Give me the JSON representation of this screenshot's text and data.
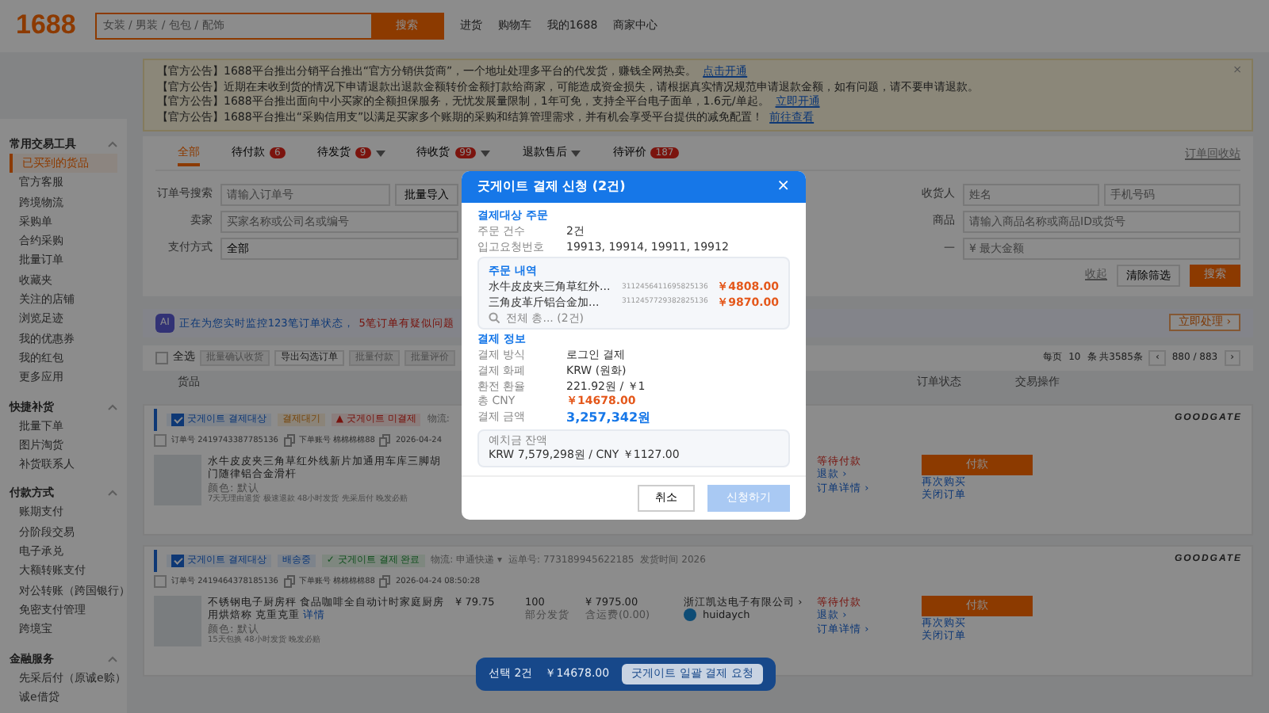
{
  "header": {
    "logo": "1688",
    "search_placeholder": "女装 / 男装 / 包包 / 配饰",
    "search_button": "搜索",
    "links": [
      "进货",
      "购物车",
      "我的1688",
      "商家中心"
    ]
  },
  "notices": {
    "close": "×",
    "items": [
      {
        "text": "【官方公告】1688平台推出分销平台推出“官方分销供货商”，一个地址处理多平台的代发货，赚钱全网热卖。",
        "link": "点击开通"
      },
      {
        "text": "【官方公告】近期在未收到货的情况下申请退款出退款金额转价金额打款给商家，可能造成资金损失，请根据真实情况规范申请退款金额，如有问题，请不要申请退款。"
      },
      {
        "text": "【官方公告】1688平台推出面向中小买家的全额担保服务，无忧发展量限制，1年可免，支持全平台电子面单，1.6元/单起。",
        "link": "立即开通"
      },
      {
        "text": "【官方公告】1688平台推出“采购信用支”以满足买家多个账期的采购和结算管理需求，并有机会享受平台提供的减免配置！",
        "link": "前往查看"
      }
    ]
  },
  "sidebar": {
    "sections": [
      {
        "title": "常用交易工具",
        "items": [
          {
            "label": "已买到的货品",
            "selected": true
          },
          {
            "label": "官方客服",
            "selected": false
          },
          {
            "label": "跨境物流",
            "selected": false
          },
          {
            "label": "采购单",
            "selected": false
          },
          {
            "label": "合约采购",
            "selected": false
          },
          {
            "label": "批量订单",
            "selected": false
          },
          {
            "label": "收藏夹",
            "selected": false
          },
          {
            "label": "关注的店铺",
            "selected": false
          },
          {
            "label": "浏览足迹",
            "selected": false
          },
          {
            "label": "我的优惠券",
            "selected": false
          },
          {
            "label": "我的红包",
            "selected": false
          },
          {
            "label": "更多应用",
            "selected": false
          }
        ]
      },
      {
        "title": "快捷补货",
        "items": [
          {
            "label": "批量下单",
            "selected": false
          },
          {
            "label": "图片淘货",
            "selected": false
          },
          {
            "label": "补货联系人",
            "selected": false
          }
        ]
      },
      {
        "title": "付款方式",
        "items": [
          {
            "label": "账期支付",
            "selected": false
          },
          {
            "label": "分阶段交易",
            "selected": false
          },
          {
            "label": "电子承兑",
            "selected": false
          },
          {
            "label": "大额转账支付",
            "selected": false
          },
          {
            "label": "对公转账（跨国银行）",
            "selected": false
          },
          {
            "label": "免密支付管理",
            "selected": false
          },
          {
            "label": "跨境宝",
            "selected": false
          }
        ]
      },
      {
        "title": "金融服务",
        "items": [
          {
            "label": "先采后付（原诚e赊）",
            "selected": false
          },
          {
            "label": "诚e借贷",
            "selected": false
          }
        ]
      }
    ]
  },
  "tabs": [
    {
      "label": "全部",
      "selected": true
    },
    {
      "label": "待付款",
      "badge": "6",
      "selected": false
    },
    {
      "label": "待发货",
      "badge": "9",
      "dropdown": true,
      "selected": false
    },
    {
      "label": "待收货",
      "badge": "99",
      "dropdown": true,
      "selected": false
    },
    {
      "label": "退款售后",
      "dropdown": true,
      "selected": false
    },
    {
      "label": "待评价",
      "badge": "187",
      "selected": false
    }
  ],
  "recycle_link": "订单回收站",
  "filters": {
    "rows": [
      {
        "label": "订单号搜索",
        "placeholder": "请输入订单号",
        "button": "批量导入",
        "right_label": "收货人",
        "right_placeholders": [
          "姓名",
          "手机号码"
        ]
      },
      {
        "label": "卖家",
        "placeholder": "买家名称或公司名或编号",
        "right_label": "商品",
        "right_placeholders": [
          "请输入商品名称或商品ID或货号"
        ]
      },
      {
        "label": "支付方式",
        "value": "全部",
        "right_label": "—",
        "right_placeholders": [
          "¥ 最大金额"
        ]
      }
    ],
    "collapse": "收起",
    "clear": "清除筛选",
    "search": "搜索"
  },
  "ai_banner": {
    "icon": "AI",
    "message": "正在为您实时监控123笔订单状态，",
    "alert": "5笔订单有疑似问题",
    "action": "立即处理 ›"
  },
  "list_toolbar": {
    "select_all": "全选",
    "select_all_checked": false,
    "buttons": [
      {
        "label": "批量确认收货",
        "disabled": true
      },
      {
        "label": "导出勾选订单",
        "disabled": false
      },
      {
        "label": "批量付款",
        "disabled": true
      },
      {
        "label": "批量评价",
        "disabled": true
      }
    ],
    "per_page_label": "每页",
    "per_page": "10",
    "total": "条 共3585条",
    "prev": "‹",
    "page": "880 / 883",
    "next": "›"
  },
  "columns": [
    "货品",
    "订单状态",
    "交易操作"
  ],
  "orders": [
    {
      "goodgate_checked": true,
      "goodgate_tag": "굿게이트 결제대상",
      "status_tag": {
        "kind": "pending",
        "text": "결제대기"
      },
      "pay_flag": {
        "kind": "warning",
        "text": "▲ 굿게이트 미결제"
      },
      "logistics": "物流:",
      "brand": "GOODGATE",
      "selected": false,
      "order_no": "订单号 2419743387785136",
      "account": "下单账号 棉棉棉棉88",
      "time": "2026-04-24",
      "product": {
        "title": "水牛皮皮夹三角草红外线新片加通用车库三脚胡门随律铝合金滑杆",
        "variant": "颜色: 默认",
        "tags": "7天无理由退货 极速退款 48小时发货 先采后付 晚发必赔"
      },
      "status": "等待付款",
      "refund": "退款 ›",
      "detail": "订单详情 ›",
      "actions": {
        "pay": "付款",
        "rebuy": "再次购买",
        "close": "关闭订单"
      }
    },
    {
      "goodgate_checked": true,
      "goodgate_tag": "굿게이트 결제대상",
      "status_tag": {
        "kind": "shipping",
        "text": "배송중"
      },
      "pay_flag": {
        "kind": "done",
        "text": "✓ 굿게이트 결제 완료"
      },
      "logistics": "物流: 申通快递 ▾",
      "waybill": "运单号: 773189945622185",
      "ship_time": "发货时间 2026",
      "brand": "GOODGATE",
      "selected": false,
      "order_no": "订单号 2419464378185136",
      "account": "下单账号 棉棉棉棉88",
      "time": "2026-04-24 08:50:28",
      "product": {
        "title": "不锈钢电子厨房秤 食品咖啡全自动计时家庭厨房用烘焙称 克重克重",
        "tag": "详情",
        "variant": "颜色: 默认",
        "tags": "15天包换 48小时发货 晚发必赔"
      },
      "price": "¥ 79.75",
      "qty": "100",
      "qty_note": "部分发货",
      "total": "¥ 7975.00",
      "total_note": "含运费(0.00)",
      "seller": "浙江凯达电子有限公司 ›",
      "seller_im": "huidaych",
      "status": "等待付款",
      "refund": "退款 ›",
      "detail": "订单详情 ›",
      "actions": {
        "pay": "付款",
        "rebuy": "再次购买",
        "close": "关闭订单"
      }
    }
  ],
  "bottom_bar": {
    "selected": "선택 2건",
    "amount": "￥14678.00",
    "button": "굿게이트 일괄 결제 요청"
  },
  "modal": {
    "title": "굿게이트 결제 신청 (2건)",
    "close": "×",
    "target": {
      "heading": "결제대상 주문",
      "rows": [
        {
          "label": "주문 건수",
          "value": "2건"
        },
        {
          "label": "입고요청번호",
          "value": "19913, 19914, 19911, 19912"
        }
      ]
    },
    "orders_box": {
      "heading": "주문 내역",
      "items": [
        {
          "name": "水牛皮皮夹三角草红外...",
          "code": "3112456411695825136",
          "price": "￥4808.00"
        },
        {
          "name": "三角皮革斤铝合金加...",
          "code": "3112457729382825136",
          "price": "￥9870.00"
        }
      ],
      "more": "전체 총... (2건)"
    },
    "payment": {
      "heading": "결제 정보",
      "rows": [
        {
          "label": "결제 방식",
          "value": "로그인 결제",
          "kind": "plain"
        },
        {
          "label": "결제 화폐",
          "value": "KRW (원화)",
          "kind": "plain"
        },
        {
          "label": "환전 환율",
          "value": "221.92원 / ￥1",
          "kind": "plain"
        },
        {
          "label": "총 CNY",
          "value": "￥14678.00",
          "kind": "cny"
        },
        {
          "label": "결제 금액",
          "value": "3,257,342원",
          "kind": "total"
        }
      ]
    },
    "deposit": {
      "label": "예치금 잔액",
      "value": "KRW 7,579,298원 / CNY ￥1127.00"
    },
    "cancel": "취소",
    "submit": "신청하기",
    "submit_disabled": true
  }
}
